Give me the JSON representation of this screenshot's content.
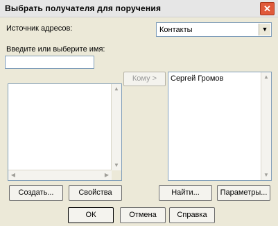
{
  "window": {
    "title": "Выбрать получателя для поручения",
    "close_symbol": "✕"
  },
  "source": {
    "label": "Источник адресов:",
    "selected": "Контакты",
    "dropdown_symbol": "▼"
  },
  "name_field": {
    "label": "Введите или выберите имя:",
    "value": ""
  },
  "to_button": "Кому >",
  "recipients": [
    "Сергей Громов"
  ],
  "scroll_symbols": {
    "up": "▲",
    "down": "▼",
    "left": "◀",
    "right": "▶"
  },
  "buttons": {
    "create": "Создать...",
    "properties": "Свойства",
    "find": "Найти...",
    "options": "Параметры...",
    "ok": "ОК",
    "cancel": "Отмена",
    "help": "Справка"
  }
}
